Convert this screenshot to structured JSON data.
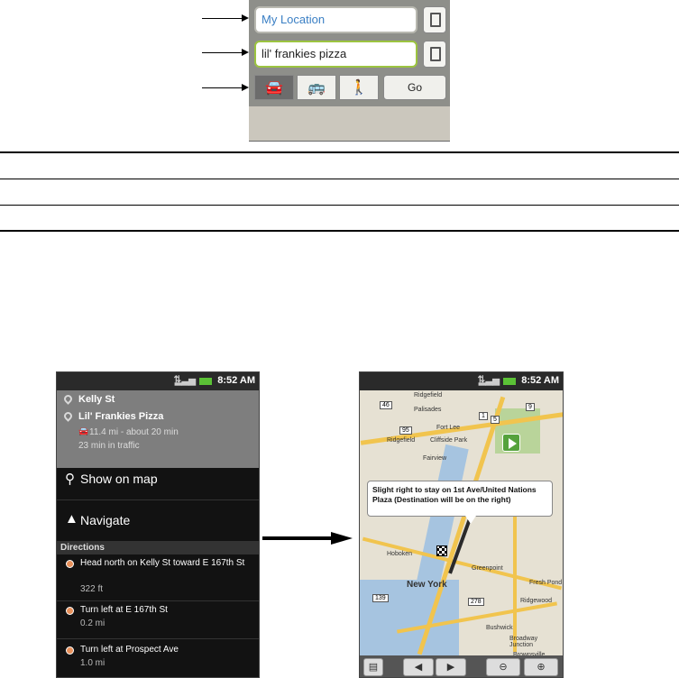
{
  "top_panel": {
    "location_field": "My Location",
    "destination_field": "lil' frankies pizza",
    "mode_icons": [
      "car-icon",
      "bus-icon",
      "walk-icon"
    ],
    "go_label": "Go"
  },
  "left_phone": {
    "status_time": "8:52 AM",
    "from": "Kelly St",
    "to": "Lil' Frankies Pizza",
    "distance_line": "11.4 mi - about 20 min",
    "traffic_line": "23 min in traffic",
    "show_on_map": "Show on map",
    "navigate": "Navigate",
    "section_label": "Directions",
    "steps": [
      {
        "text": "Head north on Kelly St toward E 167th St",
        "dist": "322 ft"
      },
      {
        "text": "Turn left at E 167th St",
        "dist": "0.2 mi"
      },
      {
        "text": "Turn left at Prospect Ave",
        "dist": "1.0 mi"
      }
    ]
  },
  "right_phone": {
    "status_time": "8:52 AM",
    "bubble_text": "Slight right to stay on 1st Ave/United Nations Plaza (Destination will be on the right)",
    "map_labels": [
      "Ridgefield",
      "Palisades",
      "Fort Lee",
      "Ridgefield",
      "Cliffside Park",
      "Fairview",
      "Hoboken",
      "New York",
      "Greenpoint",
      "Fresh Pond",
      "Ridgewood",
      "Bushwick",
      "Broadway Junction",
      "Brownsville"
    ],
    "route_shields": [
      "46",
      "1",
      "5",
      "9",
      "95",
      "139",
      "278"
    ]
  },
  "colors": {
    "accent_blue": "#3a7fc4",
    "traffic_green": "#5bc236",
    "dest_green": "#9cc440"
  }
}
